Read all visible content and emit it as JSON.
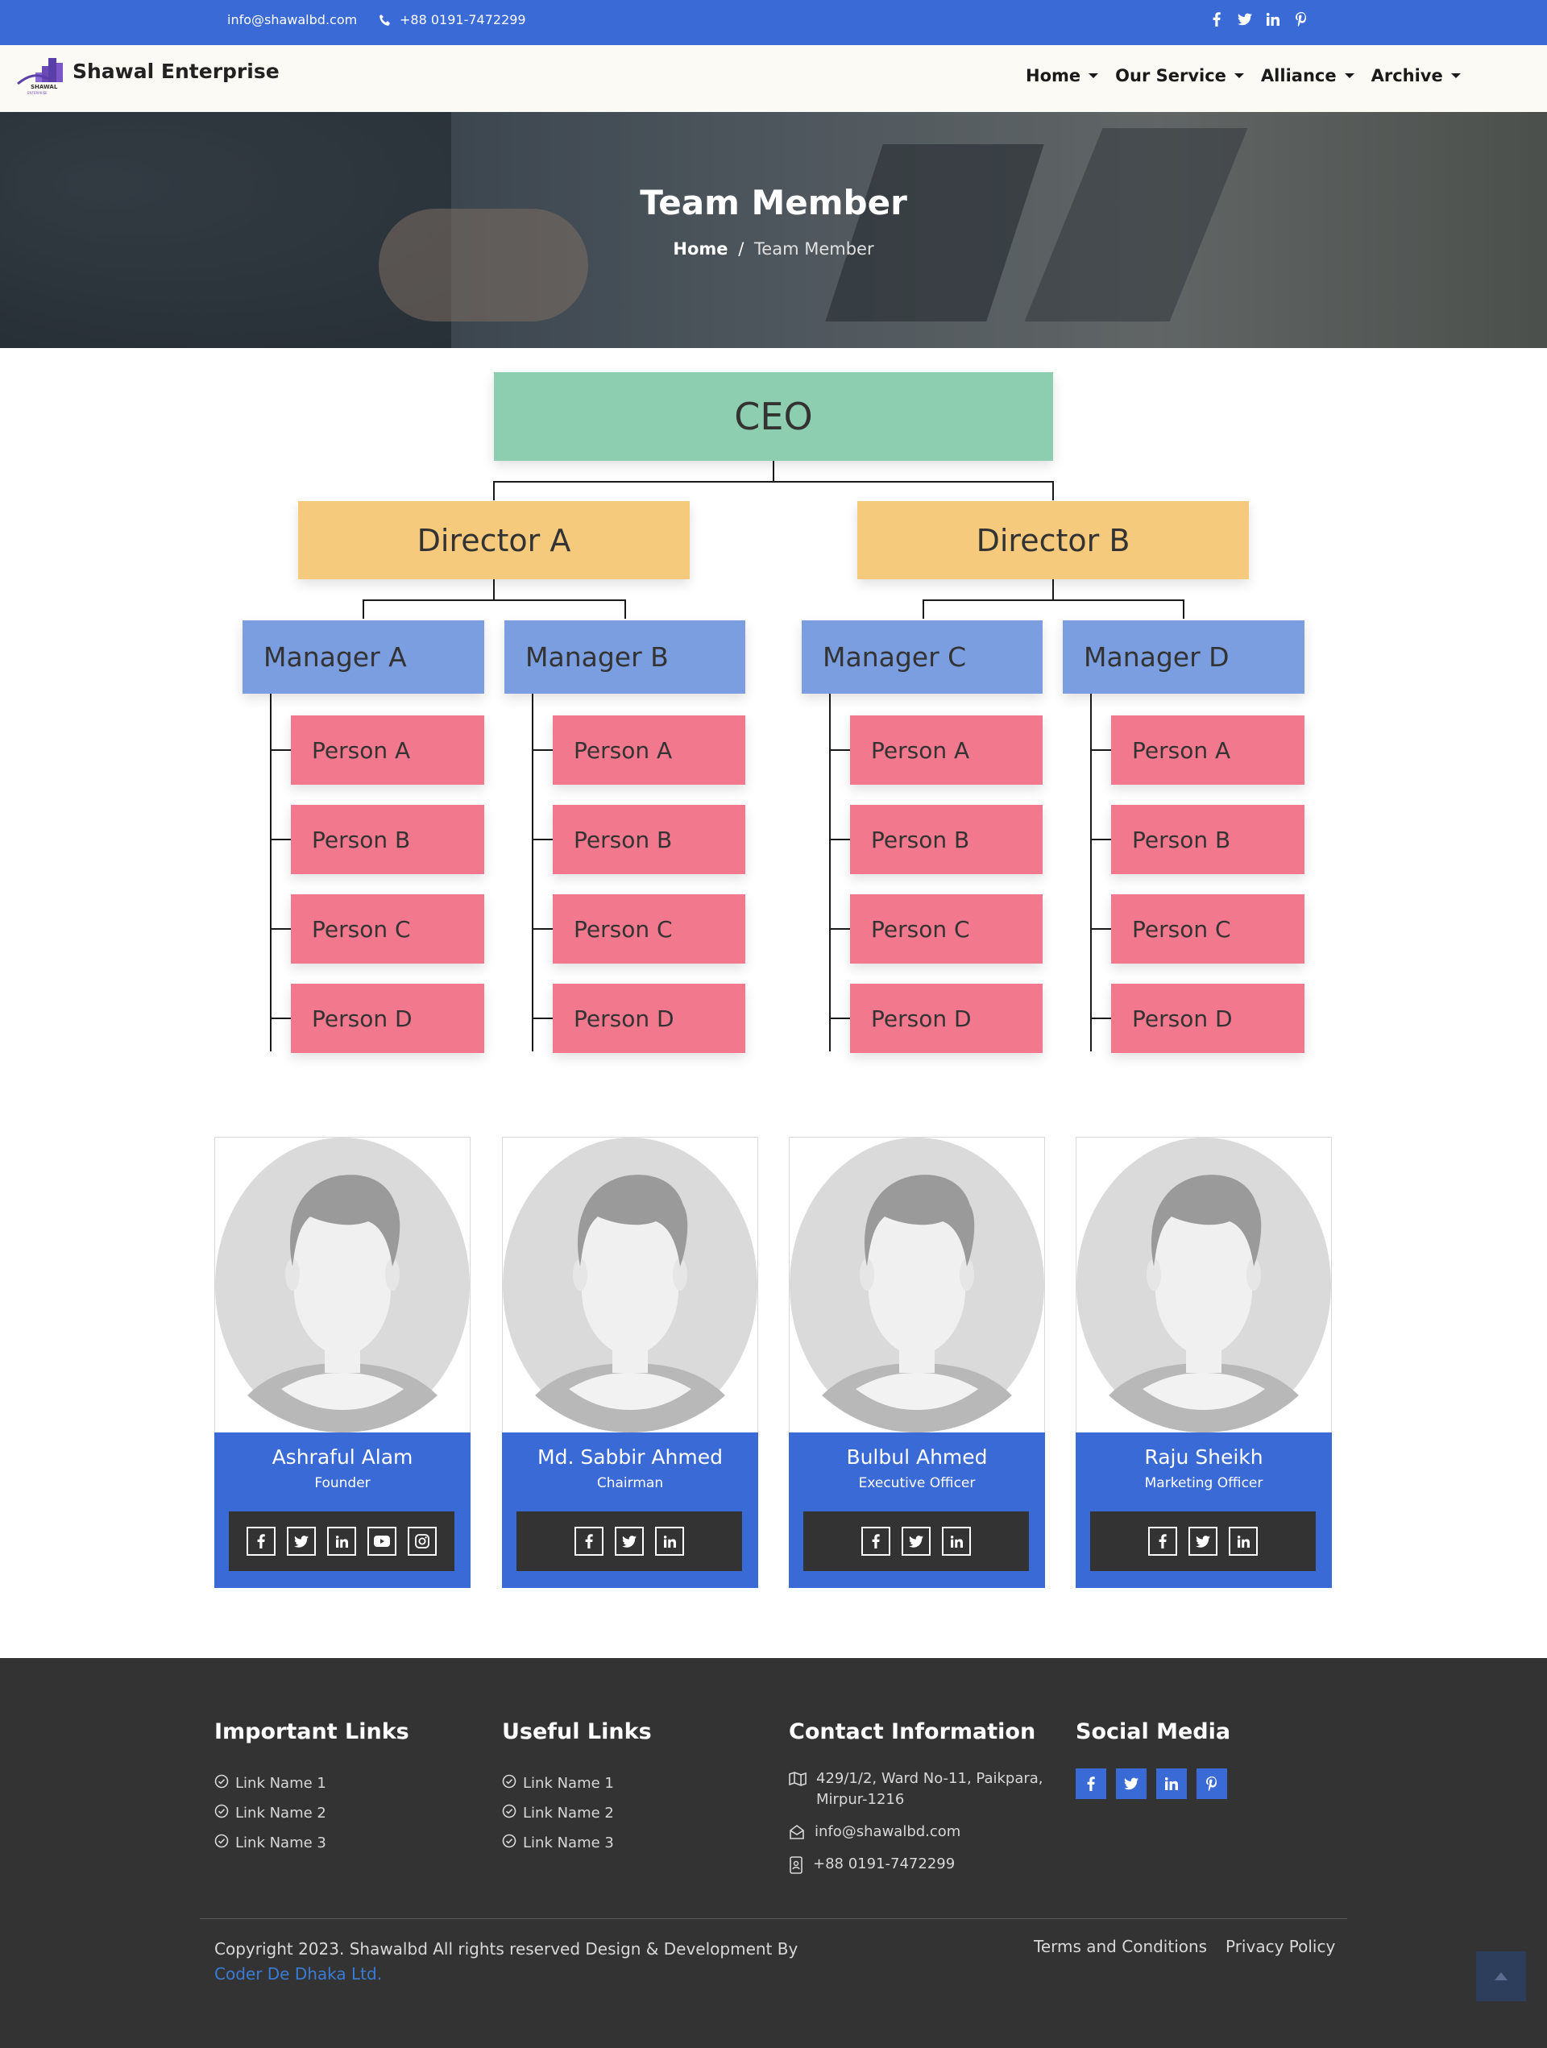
{
  "topbar": {
    "email": "info@shawalbd.com",
    "phone": "+88 0191-7472299",
    "social_icons": [
      "facebook-icon",
      "twitter-icon",
      "linkedin-icon",
      "pinterest-icon"
    ]
  },
  "brand": {
    "name": "Shawal Enterprise",
    "logo_text": "SHAWAL",
    "logo_subtext": "ENTERPRISE"
  },
  "nav": {
    "items": [
      {
        "label": "Home"
      },
      {
        "label": "Our Service"
      },
      {
        "label": "Alliance"
      },
      {
        "label": "Archive"
      }
    ]
  },
  "hero": {
    "title": "Team Member",
    "breadcrumb_home": "Home",
    "breadcrumb_sep": "/",
    "breadcrumb_current": "Team Member"
  },
  "org": {
    "ceo": "CEO",
    "directors": [
      "Director A",
      "Director B"
    ],
    "managers": [
      "Manager A",
      "Manager B",
      "Manager C",
      "Manager D"
    ],
    "persons": [
      "Person A",
      "Person B",
      "Person C",
      "Person D"
    ]
  },
  "team": [
    {
      "name": "Ashraful Alam",
      "role": "Founder",
      "socials": [
        "facebook-icon",
        "twitter-icon",
        "linkedin-icon",
        "youtube-icon",
        "instagram-icon"
      ]
    },
    {
      "name": "Md. Sabbir Ahmed",
      "role": "Chairman",
      "socials": [
        "facebook-icon",
        "twitter-icon",
        "linkedin-icon"
      ]
    },
    {
      "name": "Bulbul Ahmed",
      "role": "Executive Officer",
      "socials": [
        "facebook-icon",
        "twitter-icon",
        "linkedin-icon"
      ]
    },
    {
      "name": "Raju Sheikh",
      "role": "Marketing Officer",
      "socials": [
        "facebook-icon",
        "twitter-icon",
        "linkedin-icon"
      ]
    }
  ],
  "footer": {
    "important_links": {
      "title": "Important Links",
      "links": [
        "Link Name 1",
        "Link Name 2",
        "Link Name 3"
      ]
    },
    "useful_links": {
      "title": "Useful Links",
      "links": [
        "Link Name 1",
        "Link Name 2",
        "Link Name 3"
      ]
    },
    "contact": {
      "title": "Contact Information",
      "address_line1": "429/1/2, Ward No-11, Paikpara,",
      "address_line2": "Mirpur-1216",
      "email": "info@shawalbd.com",
      "phone": "+88 0191-7472299"
    },
    "social": {
      "title": "Social Media",
      "icons": [
        "facebook-icon",
        "twitter-icon",
        "linkedin-icon",
        "pinterest-icon"
      ]
    },
    "copyright": "Copyright 2023. Shawalbd All rights reserved Design & Development By",
    "developer": "Coder De Dhaka Ltd.",
    "terms": "Terms and Conditions",
    "privacy": "Privacy Policy"
  },
  "colors": {
    "primary_blue": "#3a6ad6",
    "ceo_green": "#8dcdb0",
    "director_yellow": "#f5ca7d",
    "manager_blue": "#7b9ee0",
    "person_pink": "#f2798d",
    "footer_dark": "#333333"
  }
}
